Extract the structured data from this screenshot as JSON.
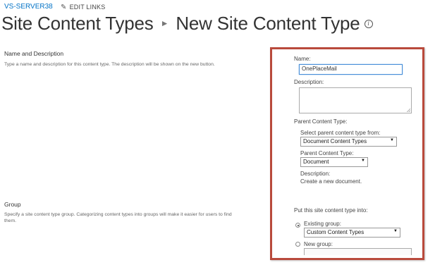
{
  "topnav": {
    "site_name": "VS-SERVER38",
    "edit_links": "EDIT LINKS"
  },
  "header": {
    "crumb_parent": "Site Content Types",
    "crumb_current": "New Site Content Type"
  },
  "sections": {
    "name_desc": {
      "heading": "Name and Description",
      "description": "Type a name and description for this content type. The description will be shown on the new button."
    },
    "group": {
      "heading": "Group",
      "description": "Specify a site content type group. Categorizing content types into groups will make it easier for users to find them."
    }
  },
  "form": {
    "name_label": "Name:",
    "name_value": "OnePlaceMail",
    "description_label": "Description:",
    "description_value": "",
    "parent_section_label": "Parent Content Type:",
    "select_from_label": "Select parent content type from:",
    "select_from_value": "Document Content Types",
    "parent_type_label": "Parent Content Type:",
    "parent_type_value": "Document",
    "parent_desc_label": "Description:",
    "parent_desc_value": "Create a new document.",
    "put_into_label": "Put this site content type into:",
    "existing_group_label": "Existing group:",
    "existing_group_value": "Custom Content Types",
    "new_group_label": "New group:",
    "selected_group_option": "existing"
  },
  "colors": {
    "link": "#0072c6",
    "highlight_border": "#b94a3c",
    "focus": "#4a90d9"
  }
}
